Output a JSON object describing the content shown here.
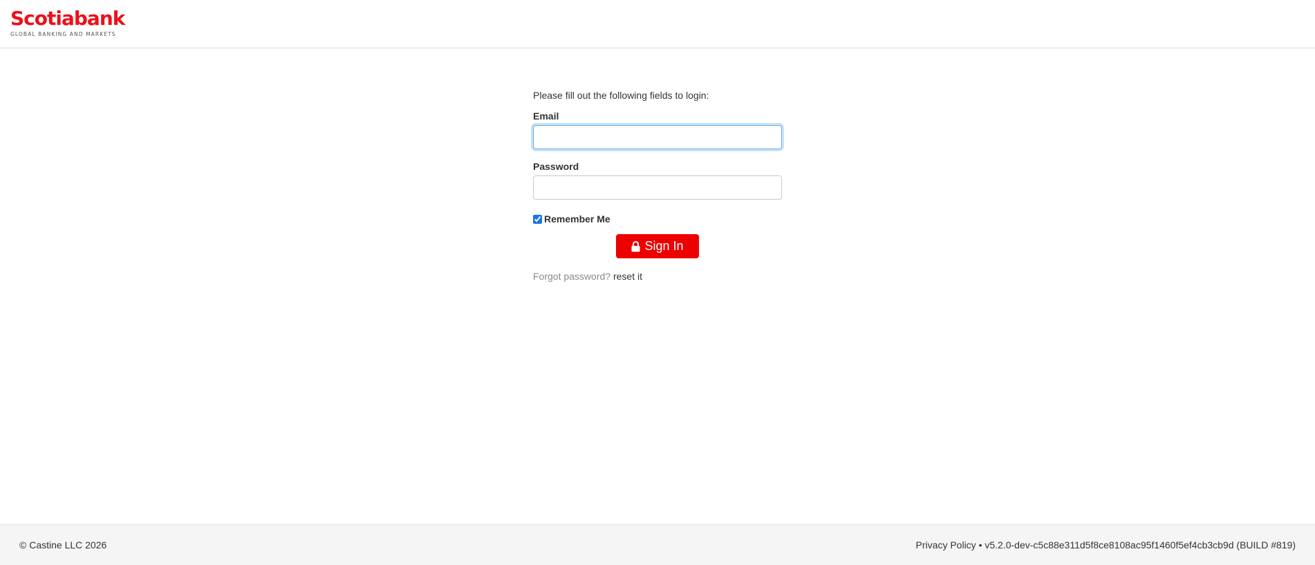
{
  "header": {
    "logo_text": "Scotiabank",
    "logo_subtitle": "GLOBAL BANKING AND MARKETS",
    "brand_color": "#ec111a"
  },
  "login": {
    "intro": "Please fill out the following fields to login:",
    "email_label": "Email",
    "email_value": "",
    "password_label": "Password",
    "password_value": "",
    "remember_label": "Remember Me",
    "remember_checked": true,
    "signin_label": "Sign In",
    "signin_icon": "lock-icon",
    "button_color": "#ec0000",
    "forgot_text": "Forgot password?",
    "reset_link": "reset it"
  },
  "footer": {
    "copyright": "© Castine LLC 2026",
    "privacy_link": "Privacy Policy",
    "separator": "•",
    "version": "v5.2.0-dev-c5c88e311d5f8ce8108ac95f1460f5ef4cb3cb9d (BUILD #819)"
  }
}
